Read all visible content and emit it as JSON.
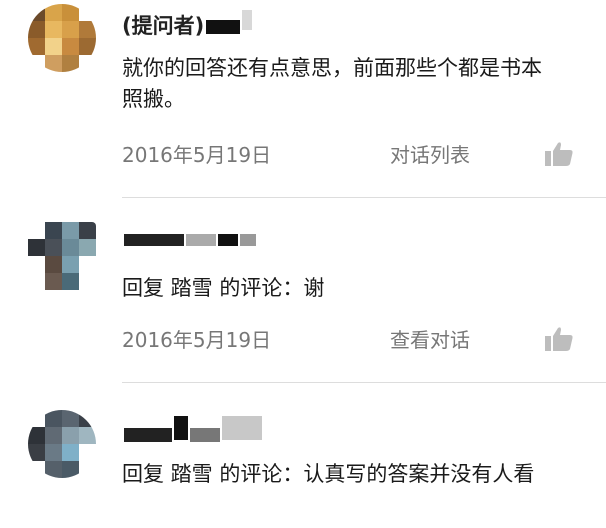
{
  "comments": [
    {
      "author": "(提问者)",
      "body": "就你的回答还有点意思，前面那些个都是书本照搬。",
      "date": "2016年5月19日",
      "action": "对话列表",
      "icon": "thumbs-up-icon"
    },
    {
      "author": "",
      "body": "回复 踏雪 的评论：谢",
      "date": "2016年5月19日",
      "action": "查看对话",
      "icon": "thumbs-up-icon"
    },
    {
      "author": "",
      "body": "回复 踏雪 的评论：认真写的答案并没有人看",
      "date": "",
      "action": "",
      "icon": ""
    }
  ],
  "colors": {
    "text": "#1a1a1a",
    "meta": "#777777",
    "divider": "#dddddd",
    "like_icon": "#bdbdbd"
  }
}
